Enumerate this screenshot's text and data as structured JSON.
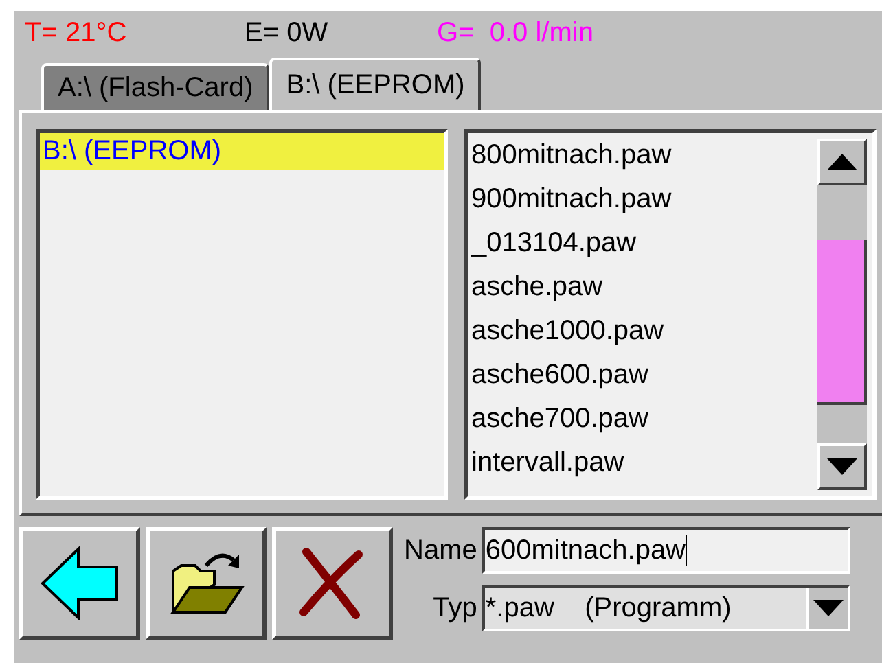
{
  "status_bar": [
    {
      "text": "T= 21°C",
      "color": "#ff0000"
    },
    {
      "text": "E= 0W",
      "color": "#000000"
    },
    {
      "text": "G=  0.0 l/min",
      "color": "#ff00ff"
    }
  ],
  "tabs": [
    {
      "label": "A:\\ (Flash-Card)",
      "selected": false
    },
    {
      "label": "B:\\ (EEPROM)",
      "selected": true
    }
  ],
  "drives": [
    {
      "label": "B:\\ (EEPROM)",
      "selected": true
    }
  ],
  "files": [
    "800mitnach.paw",
    "900mitnach.paw",
    "_013104.paw",
    "asche.paw",
    "asche1000.paw",
    "asche600.paw",
    "asche700.paw",
    "intervall.paw"
  ],
  "name_field": {
    "label": "Name",
    "value": "600mitnach.paw"
  },
  "type_field": {
    "label": "Typ",
    "value": "*.paw    (Programm)"
  }
}
